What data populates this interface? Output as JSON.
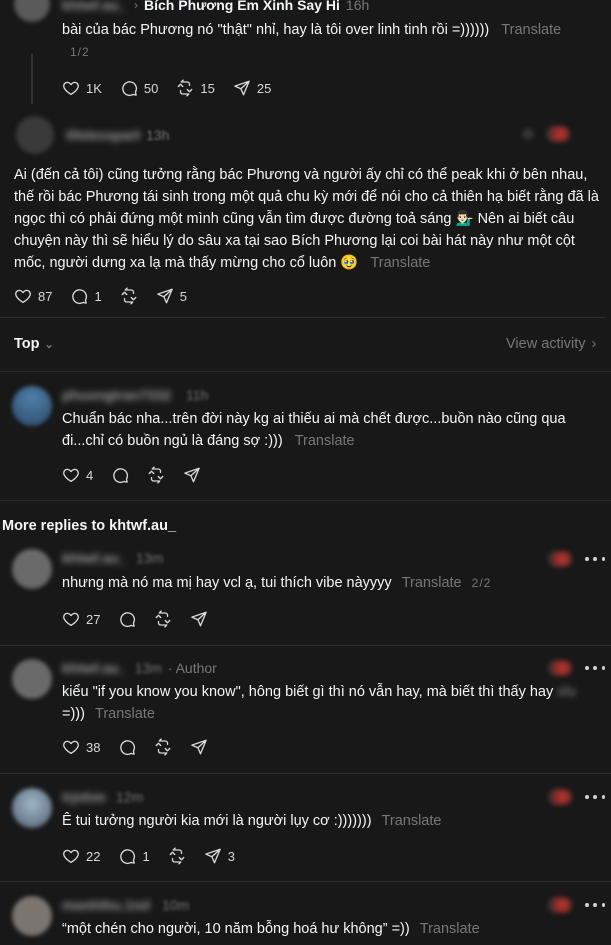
{
  "top_reply": {
    "breadcrumb": "Bích Phương Em Xinh Say Hi",
    "time": "16h",
    "author": "khtwf.au_",
    "text": "bài của bác Phương nó \"thật\" nhỉ, hay là tôi over linh tinh rồi =))))))",
    "translate": "Translate",
    "page": "1/2",
    "likes": "1K",
    "comments": "50",
    "reposts": "15",
    "shares": "25"
  },
  "main_post": {
    "author": "lifelesspark",
    "time": "13h",
    "text": "Ai (đến cả tôi) cũng tưởng rằng bác Phương và người ấy chỉ có thể peak khi ở bên nhau, thế rồi bác Phương tái sinh trong một quả chu kỳ mới để nói cho cả thiên hạ biết rằng đã là ngọc thì có phải đứng một mình cũng vẫn tìm được đường toả sáng 💁🏻‍♂️ Nên ai biết câu chuyện này thì sẽ hiểu lý do sâu xa tại sao Bích Phương lại coi bài hát này như một cột mốc, người dưng xa lạ mà thấy mừng cho cổ luôn 🥹",
    "translate": "Translate",
    "likes": "87",
    "comments": "1",
    "shares": "5"
  },
  "sort": {
    "label": "Top",
    "view_activity": "View activity"
  },
  "reply_1": {
    "author": "phuongtran7332",
    "time": "11h",
    "text": "Chuẩn bác nha...trên đời này kg ai thiếu ai mà chết được...buồn nào cũng qua đi...chỉ có buồn ngủ là đáng sợ :)))",
    "translate": "Translate",
    "likes": "4"
  },
  "more_replies": {
    "title": "More replies to khtwf.au_"
  },
  "reply_2": {
    "author": "khtwf.au_",
    "time": "13m",
    "text": "nhưng mà nó ma mị hay vcl ạ, tui thích vibe nàyyyy",
    "translate": "Translate",
    "page": "2/2",
    "likes": "27"
  },
  "reply_3": {
    "author": "khtwf.au_",
    "time": "13m",
    "tag": "· Author",
    "text": "kiểu \"if you know you know\", hông biết gì thì nó vẫn hay, mà biết thì thấy hay",
    "text_blur": "xỉu",
    "text_end": "=)))",
    "translate": "Translate",
    "likes": "38"
  },
  "reply_4": {
    "author": "trjnhm",
    "time": "12m",
    "text": "Ê tui tưởng người kia mới là người lụy cơ :)))))))",
    "translate": "Translate",
    "likes": "22",
    "comments": "1",
    "shares": "3"
  },
  "reply_5": {
    "author": "manhthu.1nd",
    "time": "10m",
    "text": "“một chén cho người, 10 năm bỗng hoá hư không” =))",
    "translate": "Translate"
  },
  "colors": {
    "background": "#181818",
    "text": "#f3f5f7",
    "muted": "#777777",
    "divider": "#2e2e2e"
  }
}
